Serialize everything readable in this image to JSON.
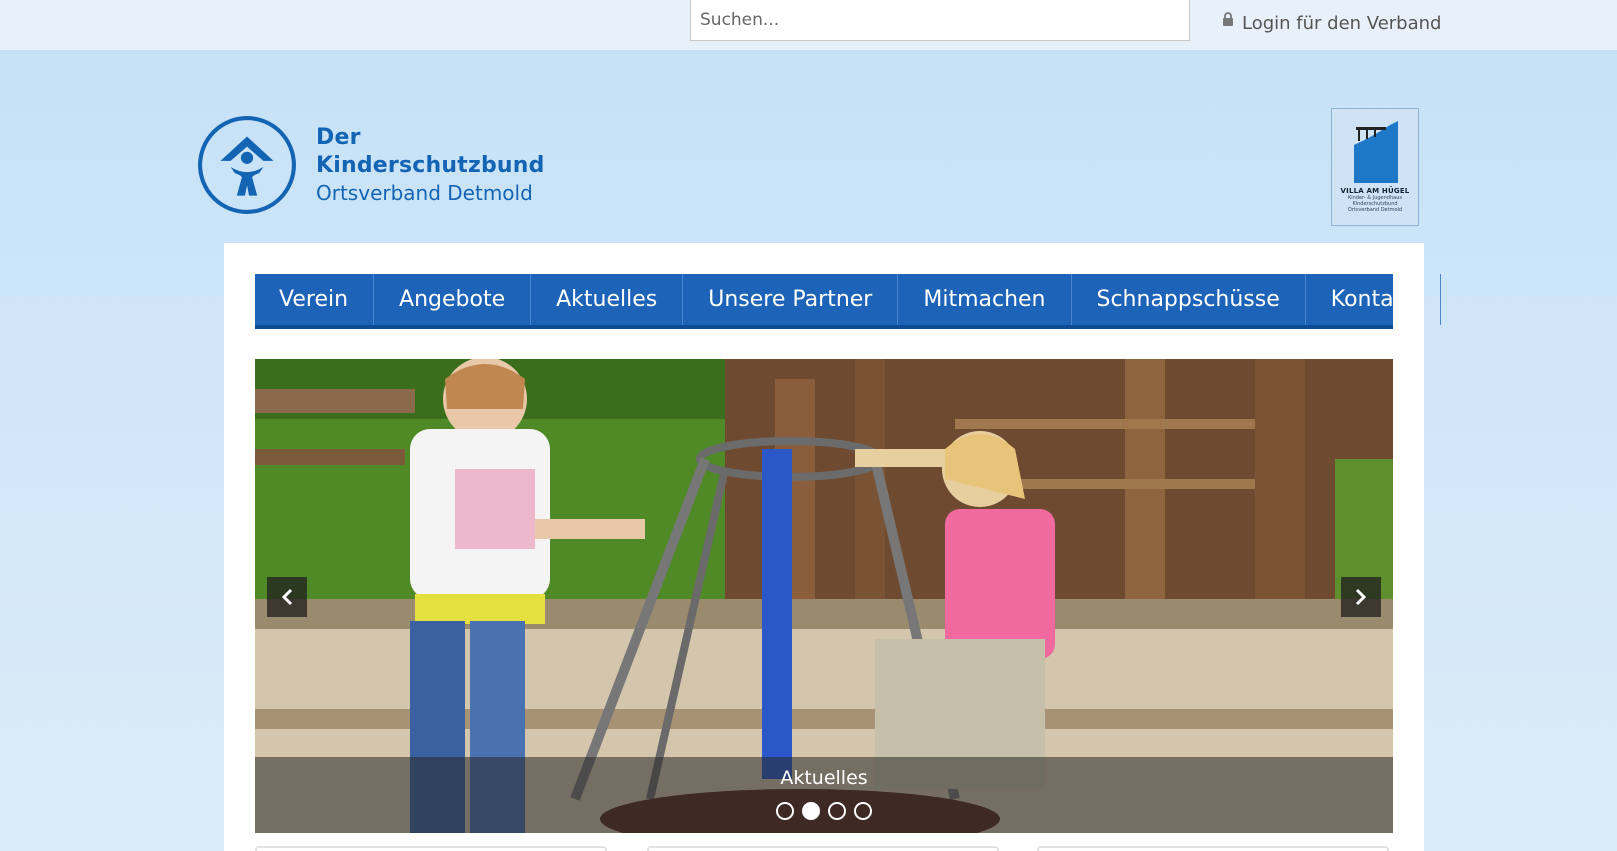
{
  "topbar": {
    "search_placeholder": "Suchen...",
    "login_label": "Login für den Verband"
  },
  "logo": {
    "line1": "Der Kinderschutzbund",
    "line2": "Ortsverband Detmold"
  },
  "villa_logo": {
    "title": "VILLA AM HÜGEL",
    "sub1": "Kinder- & Jugendhaus",
    "sub2": "Kinderschutzbund",
    "sub3": "Ortsverband Detmold"
  },
  "nav": {
    "items": [
      {
        "label": "Verein"
      },
      {
        "label": "Angebote"
      },
      {
        "label": "Aktuelles"
      },
      {
        "label": "Unsere Partner"
      },
      {
        "label": "Mitmachen"
      },
      {
        "label": "Schnappschüsse"
      },
      {
        "label": "Kontakt"
      }
    ]
  },
  "slider": {
    "caption": "Aktuelles",
    "slide_count": 4,
    "active_slide": 2
  },
  "colors": {
    "brand_blue": "#1d63b8",
    "logo_blue": "#1464b4",
    "page_bg": "#c4e0f6"
  }
}
